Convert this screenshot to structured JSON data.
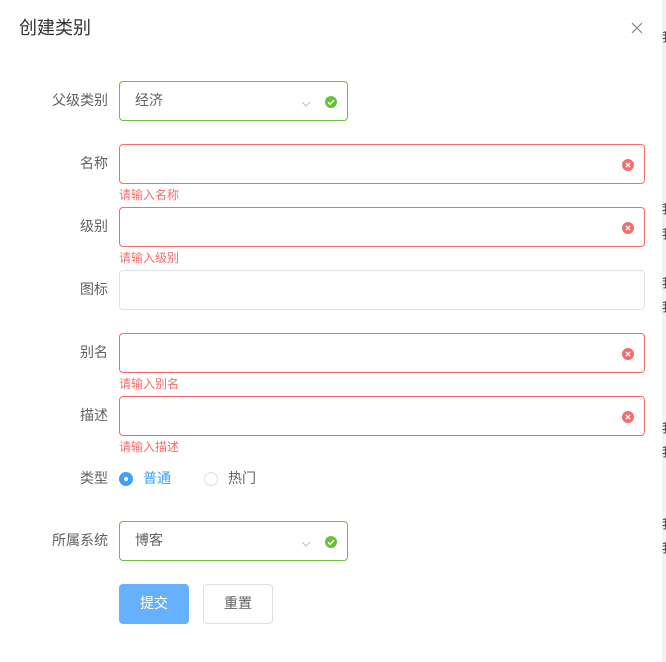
{
  "dialog": {
    "title": "创建类别"
  },
  "form": {
    "parent_category": {
      "label": "父级类别",
      "value": "经济"
    },
    "name": {
      "label": "名称",
      "value": "",
      "error": "请输入名称"
    },
    "level": {
      "label": "级别",
      "value": "",
      "error": "请输入级别"
    },
    "icon": {
      "label": "图标",
      "value": ""
    },
    "alias": {
      "label": "别名",
      "value": "",
      "error": "请输入别名"
    },
    "description": {
      "label": "描述",
      "value": "",
      "error": "请输入描述"
    },
    "type": {
      "label": "类型",
      "options": [
        "普通",
        "热门"
      ],
      "selected": "普通"
    },
    "system": {
      "label": "所属系统",
      "value": "博客"
    }
  },
  "buttons": {
    "submit": "提交",
    "reset": "重置"
  },
  "colors": {
    "error": "#f56c6c",
    "success": "#67c23a",
    "primary": "#409eff",
    "primary_light": "#66b1ff"
  }
}
